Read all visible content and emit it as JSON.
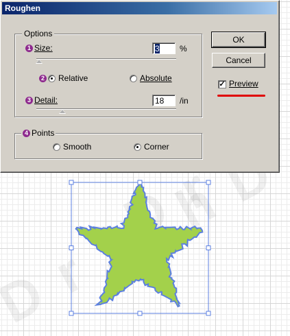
{
  "dialog": {
    "title": "Roughen",
    "options": {
      "legend": "Options",
      "size": {
        "badge": "1",
        "label": "Size:",
        "value": "3",
        "unit": "%"
      },
      "mode": {
        "badge": "2",
        "relative": "Relative",
        "absolute": "Absolute",
        "selected": "Relative"
      },
      "detail": {
        "badge": "3",
        "label": "Detail:",
        "value": "18",
        "unit": "/in"
      }
    },
    "points": {
      "badge": "4",
      "legend": "Points",
      "smooth": "Smooth",
      "corner": "Corner",
      "selected": "Corner"
    },
    "buttons": {
      "ok": "OK",
      "cancel": "Cancel"
    },
    "preview": {
      "label": "Preview",
      "checked": true,
      "check_mark": "✓"
    }
  },
  "colors": {
    "star_fill": "#a3d14b",
    "star_edge": "#5b7fe0",
    "selection": "#5b7fe0",
    "annotation_underline": "#e00000",
    "badge": "#8e2a8e"
  }
}
